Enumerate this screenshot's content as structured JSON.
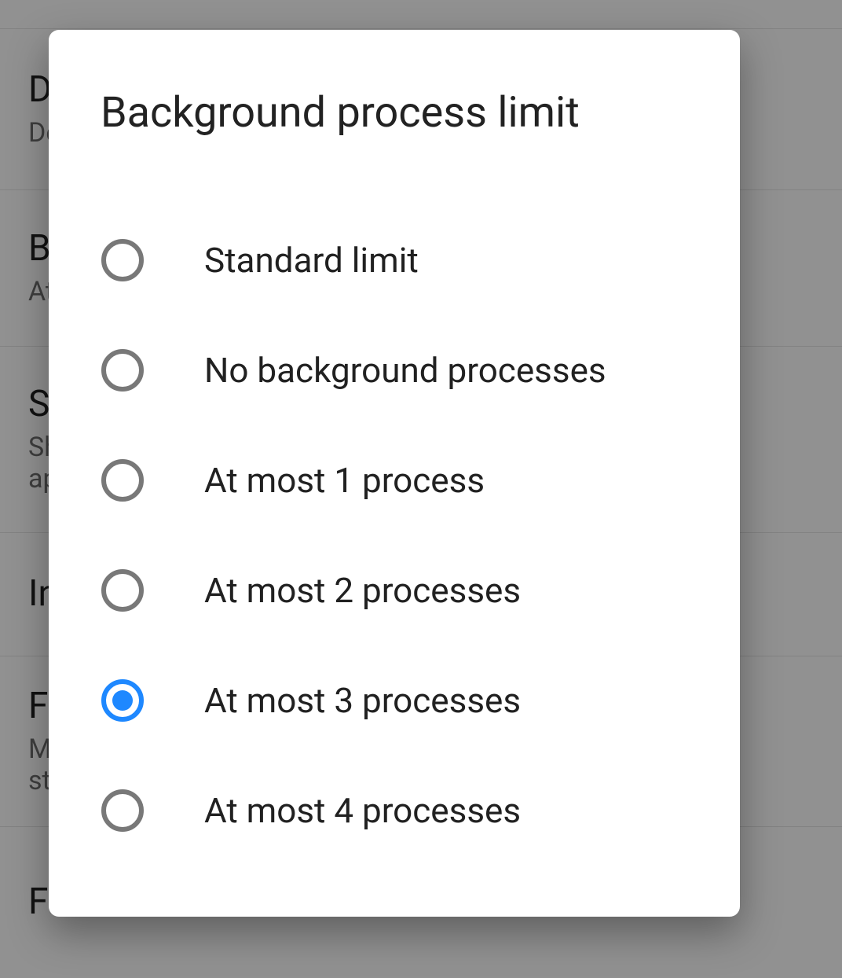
{
  "colors": {
    "accent": "#1e88ff",
    "radio_border": "#787878"
  },
  "background": {
    "rows": [
      {
        "title": "D",
        "subtitle": "De"
      },
      {
        "title": "B",
        "subtitle": "At"
      },
      {
        "title": "S",
        "subtitle": "Sh\nap"
      },
      {
        "title": "In",
        "subtitle": ""
      },
      {
        "title": "F",
        "subtitle": "M\nst"
      },
      {
        "title": "Force activities to be resizable",
        "subtitle": ""
      }
    ]
  },
  "dialog": {
    "title": "Background process limit",
    "selected_index": 4,
    "options": [
      {
        "label": "Standard limit"
      },
      {
        "label": "No background processes"
      },
      {
        "label": "At most 1 process"
      },
      {
        "label": "At most 2 processes"
      },
      {
        "label": "At most 3 processes"
      },
      {
        "label": "At most 4 processes"
      }
    ]
  }
}
